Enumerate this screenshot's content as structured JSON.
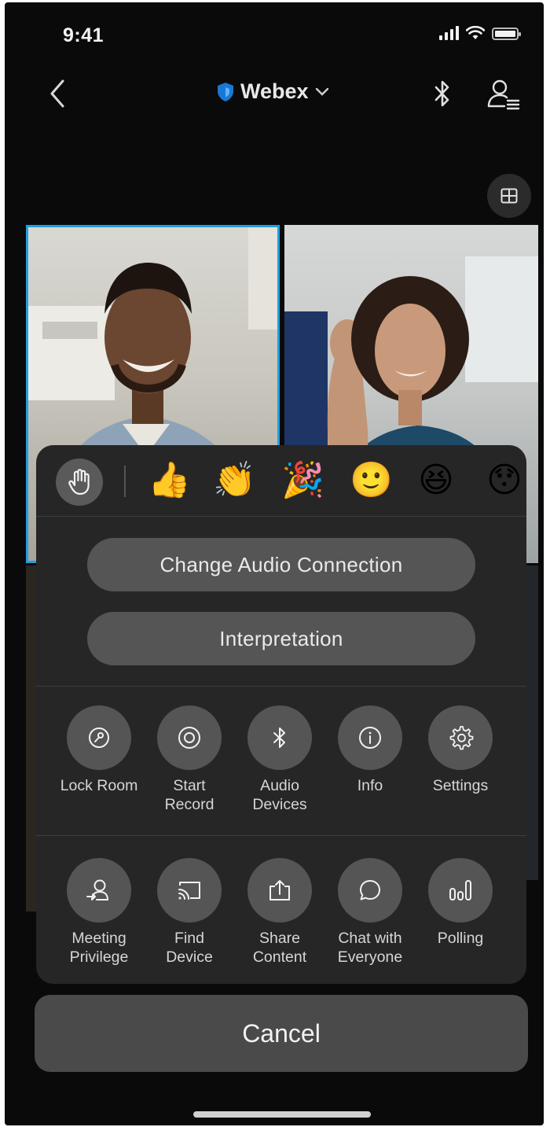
{
  "status_bar": {
    "time": "9:41"
  },
  "nav": {
    "title": "Webex"
  },
  "reactions": {
    "raise_hand": "raise-hand",
    "emojis": [
      "👍",
      "👏",
      "🎉",
      "🙂",
      "😆",
      "😯"
    ]
  },
  "actions": {
    "change_audio": "Change Audio Connection",
    "interpretation": "Interpretation"
  },
  "grid": {
    "row1": [
      {
        "label": "Lock Room",
        "icon": "lock-icon"
      },
      {
        "label": "Start\nRecord",
        "icon": "record-icon"
      },
      {
        "label": "Audio\nDevices",
        "icon": "bluetooth-icon"
      },
      {
        "label": "Info",
        "icon": "info-icon"
      },
      {
        "label": "Settings",
        "icon": "gear-icon"
      }
    ],
    "row2": [
      {
        "label": "Meeting\nPrivilege",
        "icon": "privilege-icon"
      },
      {
        "label": "Find\nDevice",
        "icon": "cast-icon"
      },
      {
        "label": "Share\nContent",
        "icon": "share-icon"
      },
      {
        "label": "Chat with\nEveryone",
        "icon": "chat-icon"
      },
      {
        "label": "Polling",
        "icon": "polling-icon"
      }
    ]
  },
  "cancel_label": "Cancel",
  "colors": {
    "active_speaker": "#1fa0e0",
    "sheet_bg": "#262626",
    "button_bg": "#555555",
    "brand_blue": "#1a78d4"
  }
}
